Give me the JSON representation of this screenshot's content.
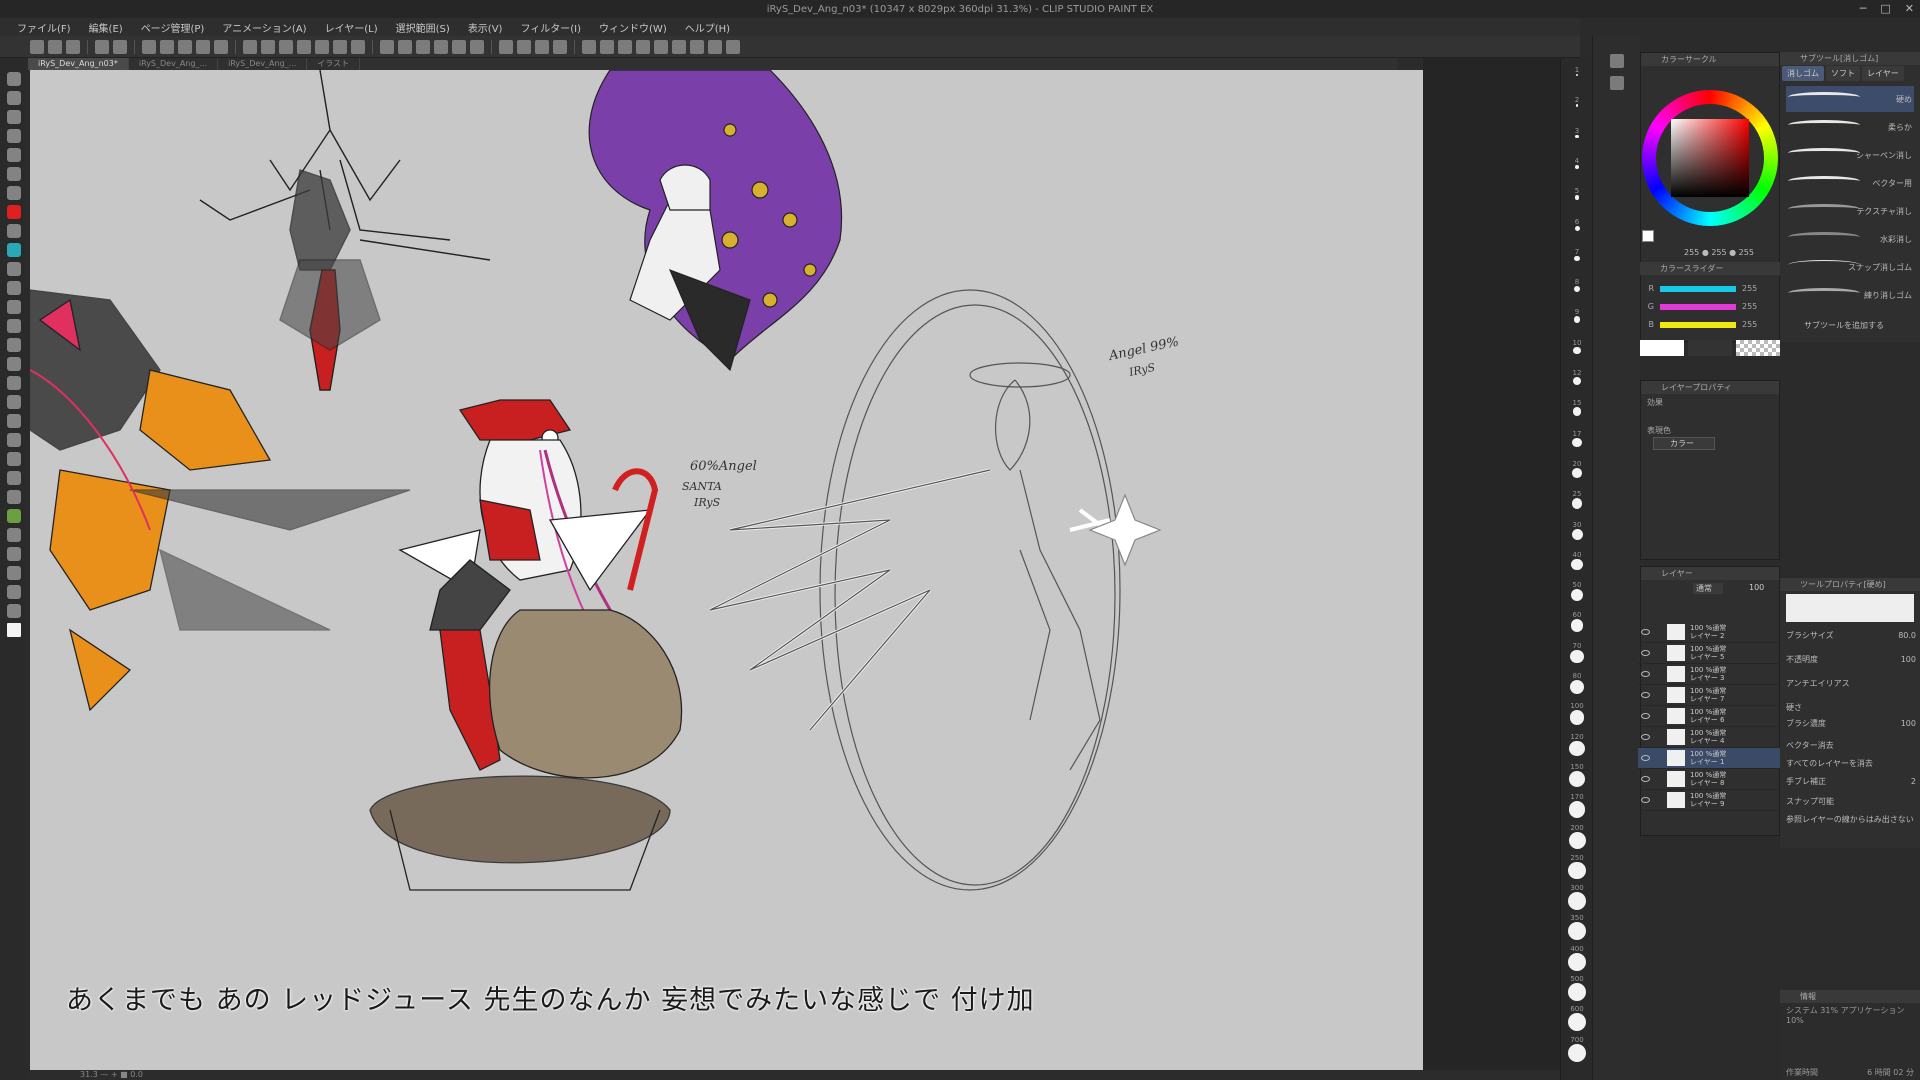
{
  "window": {
    "title": "iRyS_Dev_Ang_n03* (10347 x 8029px 360dpi 31.3%) - CLIP STUDIO PAINT EX",
    "controls": [
      "─",
      "□",
      "✕"
    ]
  },
  "menu": [
    "ファイル(F)",
    "編集(E)",
    "ページ管理(P)",
    "アニメーション(A)",
    "レイヤー(L)",
    "選択範囲(S)",
    "表示(V)",
    "フィルター(I)",
    "ウィンドウ(W)",
    "ヘルプ(H)"
  ],
  "tabs": [
    {
      "label": "iRyS_Dev_Ang_n03*",
      "active": true
    },
    {
      "label": "iRyS_Dev_Ang_...",
      "active": false
    },
    {
      "label": "iRyS_Dev_Ang_...",
      "active": false
    },
    {
      "label": "イラスト",
      "active": false
    }
  ],
  "canvas": {
    "annotations": [
      {
        "text": "60%Angel"
      },
      {
        "text": "SANTA"
      },
      {
        "text": "IRyS"
      },
      {
        "text": "Angel 99%"
      },
      {
        "text": "IRyS"
      }
    ]
  },
  "subtitle": "あくまでも あの レッドジュース 先生のなんか 妄想でみたいな感じで 付け加",
  "statusbar": "31.3  —  +  ■  0.0",
  "brush_sizes": [
    "1",
    "2",
    "3",
    "4",
    "5",
    "6",
    "7",
    "8",
    "9",
    "10",
    "12",
    "15",
    "17",
    "20",
    "25",
    "30",
    "40",
    "50",
    "60",
    "70",
    "80",
    "100",
    "120",
    "150",
    "170",
    "200",
    "250",
    "300",
    "350",
    "400",
    "500",
    "600",
    "700"
  ],
  "color_panel": {
    "header": "カラーサークル",
    "rgb_header": "カラースライダー",
    "values_line": "255 ● 255 ● 255",
    "sliders": [
      {
        "label": "R",
        "value": "255",
        "color": "#19c7e6"
      },
      {
        "label": "G",
        "value": "255",
        "color": "#e23ad8"
      },
      {
        "label": "B",
        "value": "255",
        "color": "#f0e812"
      }
    ],
    "main_color": "#ffffff",
    "accent": "#e02020"
  },
  "layer_property": {
    "header": "レイヤープロパティ",
    "effect_label": "効果",
    "expression_label": "表現色",
    "expression_value": "カラー"
  },
  "layers": {
    "header": "レイヤー",
    "blend": "通常",
    "opacity": "100",
    "items": [
      {
        "line1": "100 %通常",
        "line2": "レイヤー 2",
        "selected": false
      },
      {
        "line1": "100 %通常",
        "line2": "レイヤー 5",
        "selected": false
      },
      {
        "line1": "100 %通常",
        "line2": "レイヤー 3",
        "selected": false
      },
      {
        "line1": "100 %通常",
        "line2": "レイヤー 7",
        "selected": false
      },
      {
        "line1": "100 %通常",
        "line2": "レイヤー 6",
        "selected": false
      },
      {
        "line1": "100 %通常",
        "line2": "レイヤー 4",
        "selected": false
      },
      {
        "line1": "100 %通常",
        "line2": "レイヤー 1",
        "selected": true
      },
      {
        "line1": "100 %通常",
        "line2": "レイヤー 8",
        "selected": false
      },
      {
        "line1": "100 %通常",
        "line2": "レイヤー 9",
        "selected": false
      }
    ]
  },
  "sub_tool": {
    "header": "サブツール[消しゴム]",
    "tabs": [
      "消しゴム",
      "ソフト",
      "レイヤー"
    ],
    "brushes": [
      {
        "name": "硬め",
        "selected": true
      },
      {
        "name": "柔らか",
        "selected": false
      },
      {
        "name": "シャーペン消し",
        "selected": false
      },
      {
        "name": "ベクター用",
        "selected": false
      },
      {
        "name": "テクスチャ消し",
        "selected": false
      },
      {
        "name": "水彩消し",
        "selected": false
      },
      {
        "name": "スナップ消しゴム",
        "selected": false
      },
      {
        "name": "練り消しゴム",
        "selected": false
      }
    ],
    "add_label": "サブツールを追加する"
  },
  "tool_property": {
    "header": "ツールプロパティ[硬め]",
    "rows": [
      {
        "label": "ブラシサイズ",
        "value": "80.0"
      },
      {
        "label": "不透明度",
        "value": "100"
      },
      {
        "label": "アンチエイリアス",
        "value": ""
      },
      {
        "label": "硬さ",
        "value": ""
      },
      {
        "label": "ブラシ濃度",
        "value": "100"
      },
      {
        "label": "ベクター消去",
        "value": ""
      },
      {
        "label": "すべてのレイヤーを消去",
        "value": ""
      },
      {
        "label": "手ブレ補正",
        "value": "2"
      },
      {
        "label": "スナップ可能",
        "value": ""
      },
      {
        "label": "参照レイヤーの線からはみ出さない",
        "value": ""
      }
    ]
  },
  "navigator": {
    "header": "情報",
    "line1": "システム 31% アプリケーション 10%",
    "line2": "作業時間",
    "line3": "6 時間 02 分"
  }
}
